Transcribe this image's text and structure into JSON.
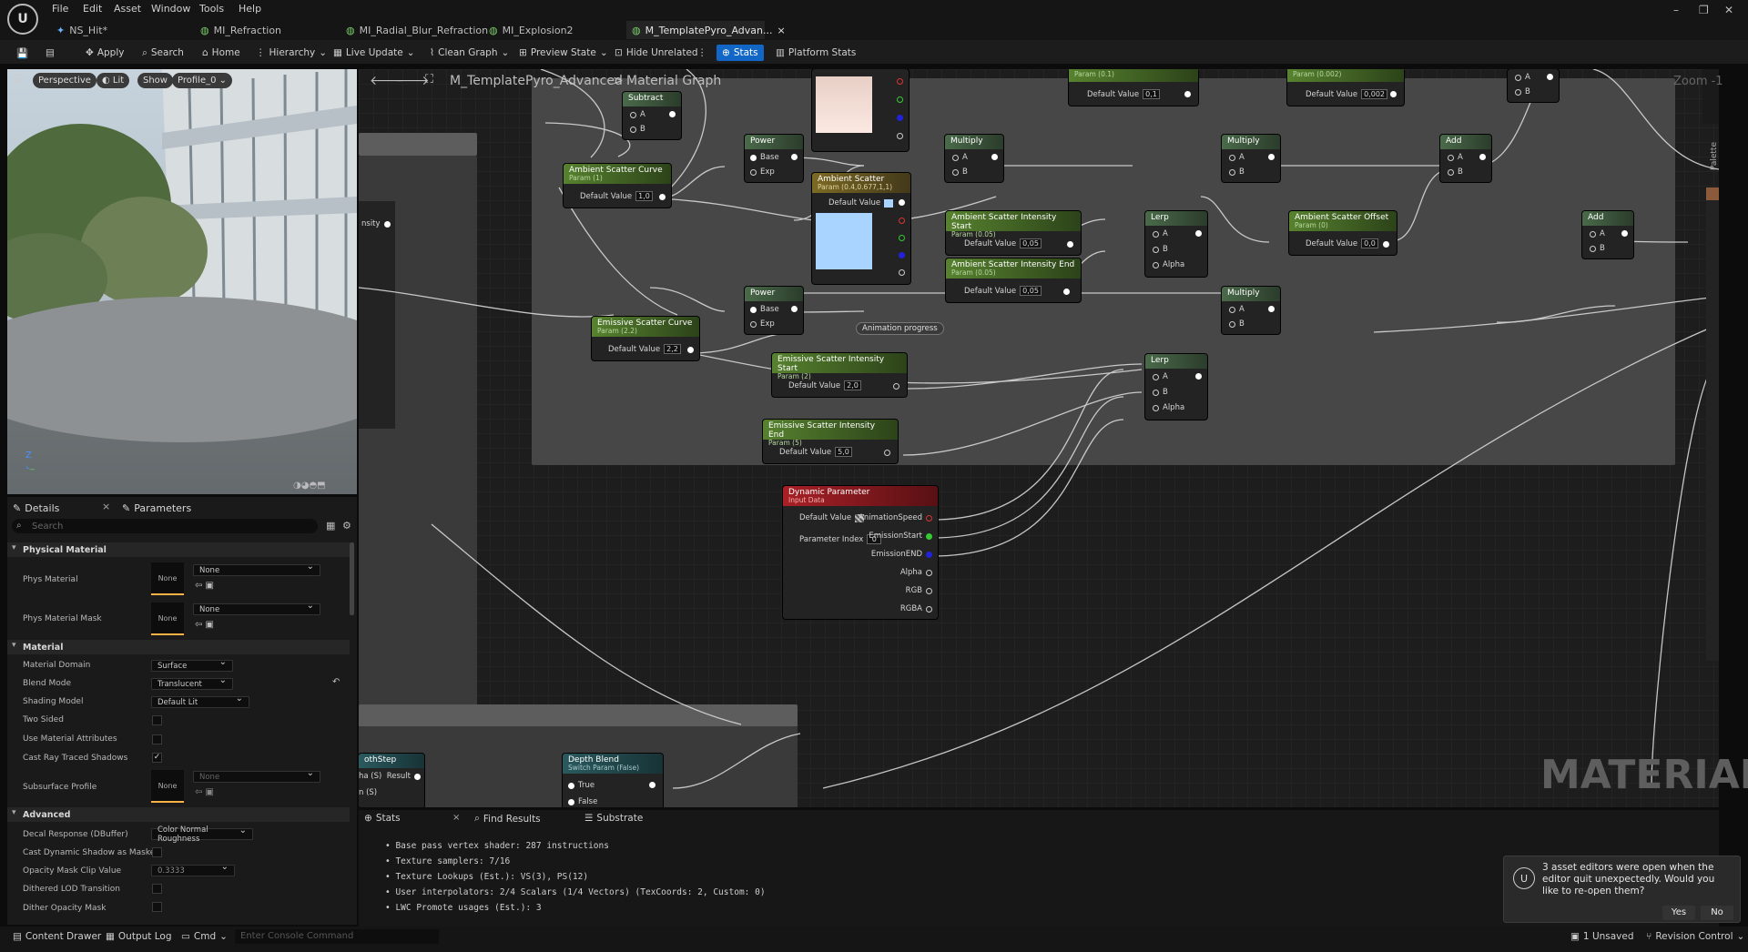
{
  "menu": [
    "File",
    "Edit",
    "Asset",
    "Window",
    "Tools",
    "Help"
  ],
  "tabs": [
    "NS_Hit*",
    "MI_Refraction",
    "MI_Radial_Blur_Refraction",
    "MI_Explosion2",
    "M_TemplatePyro_Advan..."
  ],
  "tab_close": "×",
  "window_controls": {
    "minimize": "–",
    "restore": "❐",
    "close": "✕"
  },
  "toolbar": {
    "apply": "Apply",
    "search": "Search",
    "home": "Home",
    "hierarchy": "Hierarchy",
    "live_update": "Live Update",
    "clean_graph": "Clean Graph",
    "preview_state": "Preview State",
    "hide_unrelated": "Hide Unrelated",
    "stats": "Stats",
    "platform_stats": "Platform Stats"
  },
  "viewport": {
    "perspective": "Perspective",
    "lit": "Lit",
    "show": "Show",
    "profile": "Profile_0"
  },
  "details": {
    "tab_details": "Details",
    "tab_parameters": "Parameters",
    "search_placeholder": "Search",
    "sections": {
      "physical": "Physical Material",
      "material": "Material",
      "advanced": "Advanced"
    },
    "props": {
      "phys_material": "Phys Material",
      "phys_material_value": "None",
      "phys_material_thumb": "None",
      "phys_mask": "Phys Material Mask",
      "phys_mask_value": "None",
      "phys_mask_thumb": "None",
      "domain": "Material Domain",
      "domain_value": "Surface",
      "blend": "Blend Mode",
      "blend_value": "Translucent",
      "shading": "Shading Model",
      "shading_value": "Default Lit",
      "two_sided": "Two Sided",
      "use_attr": "Use Material Attributes",
      "cast_rt": "Cast Ray Traced Shadows",
      "subsurface": "Subsurface Profile",
      "subsurface_value": "None",
      "subsurface_thumb": "None",
      "decal": "Decal Response (DBuffer)",
      "decal_value": "Color Normal Roughness",
      "cast_dyn": "Cast Dynamic Shadow as Masked",
      "clip": "Opacity Mask Clip Value",
      "clip_value": "0.3333",
      "dithered": "Dithered LOD Transition",
      "dither_opacity": "Dither Opacity Mask"
    }
  },
  "graph": {
    "breadcrumb_material": "M_TemplatePyro_Advanced",
    "breadcrumb_sep": ">",
    "breadcrumb_graph": "Material Graph",
    "zoom": "Zoom -1",
    "palette": "Palette",
    "watermark": "MATERIAL",
    "reroute_label": "Animation progress",
    "nodes": {
      "subtract": {
        "title": "Subtract",
        "a": "A",
        "b": "B"
      },
      "power1": {
        "title": "Power",
        "base": "Base",
        "exp": "Exp"
      },
      "power2": {
        "title": "Power",
        "base": "Base",
        "exp": "Exp"
      },
      "multiply1": {
        "title": "Multiply",
        "a": "A",
        "b": "B"
      },
      "multiply2": {
        "title": "Multiply",
        "a": "A",
        "b": "B"
      },
      "multiply3": {
        "title": "Multiply",
        "a": "A",
        "b": "B"
      },
      "add1": {
        "title": "Add",
        "a": "A",
        "b": "B"
      },
      "add2": {
        "title": "Add",
        "a": "A",
        "b": "B"
      },
      "lerp1": {
        "title": "Lerp",
        "a": "A",
        "b": "B",
        "alpha": "Alpha"
      },
      "lerp2": {
        "title": "Lerp",
        "a": "A",
        "b": "B",
        "alpha": "Alpha"
      },
      "asc": {
        "title": "Ambient Scatter Curve",
        "sub": "Param (1)",
        "dv": "Default Value",
        "val": "1,0"
      },
      "as": {
        "title": "Ambient Scatter",
        "sub": "Param (0.4,0.677,1,1)",
        "dv": "Default Value"
      },
      "asis": {
        "title": "Ambient Scatter Intensity Start",
        "sub": "Param (0.05)",
        "dv": "Default Value",
        "val": "0,05"
      },
      "asie": {
        "title": "Ambient Scatter Intensity End",
        "sub": "Param (0.05)",
        "dv": "Default Value",
        "val": "0,05"
      },
      "aso": {
        "title": "Ambient Scatter Offset",
        "sub": "Param (0)",
        "dv": "Default Value",
        "val": "0,0"
      },
      "esc": {
        "title": "Emissive Scatter Curve",
        "sub": "Param (2.2)",
        "dv": "Default Value",
        "val": "2,2"
      },
      "esis": {
        "title": "Emissive Scatter Intensity Start",
        "sub": "Param (2)",
        "dv": "Default Value",
        "val": "2,0"
      },
      "esie": {
        "title": "Emissive Scatter Intensity End",
        "sub": "Param (5)",
        "dv": "Default Value",
        "val": "5,0"
      },
      "top1": {
        "dv": "Default Value",
        "val": "0,1",
        "sub": "Param (0.1)"
      },
      "top2": {
        "dv": "Default Value",
        "val": "0,002",
        "sub": "Param (0.002)"
      },
      "dyn": {
        "title": "Dynamic Parameter",
        "sub": "Input Data",
        "dv": "Default Value",
        "pi": "Parameter Index",
        "pi_val": "0",
        "outs": [
          "AnimationSpeed",
          "EmissionStart",
          "EmissionEND",
          "Alpha",
          "RGB",
          "RGBA"
        ]
      },
      "depth": {
        "title": "Depth Blend",
        "sub": "Switch Param (False)",
        "t": "True",
        "f": "False"
      },
      "depthstep": {
        "title": "othStep",
        "a": "ha (S)",
        "result": "Result",
        "b": "n (S)"
      },
      "left_pin": "nsity"
    }
  },
  "bottom": {
    "tab_stats": "Stats",
    "tab_find": "Find Results",
    "tab_substrate": "Substrate",
    "lines": [
      "Base pass vertex shader: 287 instructions",
      "Texture samplers: 7/16",
      "Texture Lookups (Est.): VS(3), PS(12)",
      "User interpolators: 2/4 Scalars (1/4 Vectors) (TexCoords: 2, Custom: 0)",
      "LWC Promote usages (Est.): 3"
    ]
  },
  "toast": {
    "message": "3 asset editors were open when the editor quit unexpectedly. Would you like to re-open them?",
    "yes": "Yes",
    "no": "No"
  },
  "status": {
    "content_drawer": "Content Drawer",
    "output_log": "Output Log",
    "cmd": "Cmd",
    "console_placeholder": "Enter Console Command",
    "unsaved": "1 Unsaved",
    "revision": "Revision Control"
  },
  "colors": {
    "accent": "#1166c6",
    "param_green": "#57822f",
    "dynamic_red": "#a92026",
    "ambient_swatch": "#a9d4ff"
  }
}
